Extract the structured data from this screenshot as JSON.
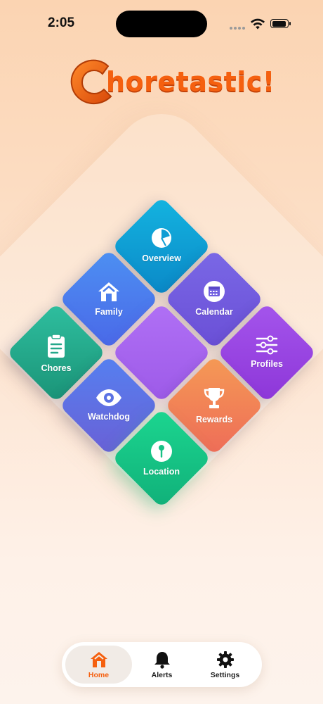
{
  "status_bar": {
    "time": "2:05"
  },
  "app": {
    "logo_letter": "C",
    "logo_rest": "horetastic!"
  },
  "menu": {
    "overview": "Overview",
    "family": "Family",
    "calendar": "Calendar",
    "chores": "Chores",
    "profiles": "Profiles",
    "watchdog": "Watchdog",
    "rewards": "Rewards",
    "location": "Location"
  },
  "tabs": {
    "home": "Home",
    "alerts": "Alerts",
    "settings": "Settings",
    "active": "home"
  },
  "colors": {
    "accent": "#f5600f"
  }
}
